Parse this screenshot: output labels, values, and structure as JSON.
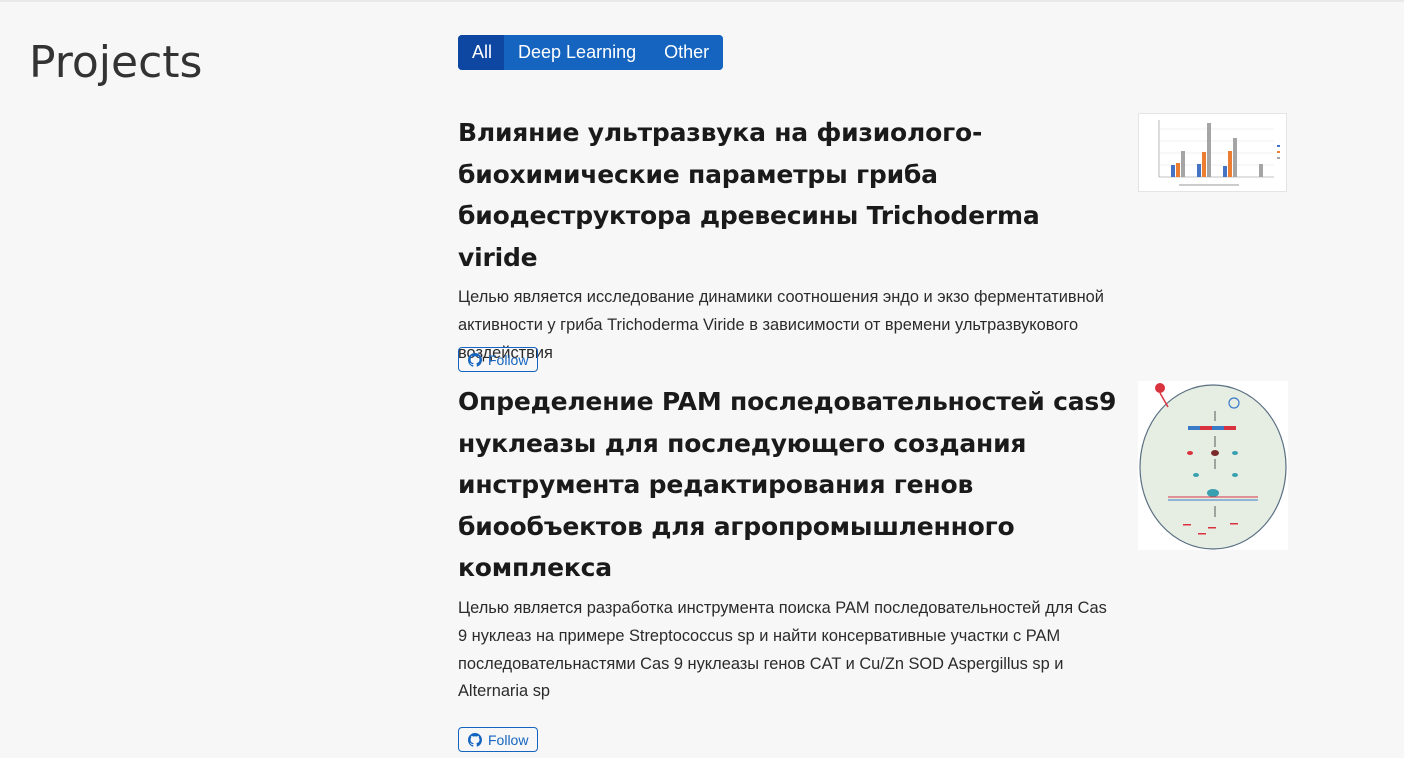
{
  "section": {
    "title": "Projects"
  },
  "filters": [
    {
      "label": "All",
      "active": true
    },
    {
      "label": "Deep Learning",
      "active": false
    },
    {
      "label": "Other",
      "active": false
    }
  ],
  "projects": [
    {
      "title": "Влияние ультразвука на физиолого-биохимические параметры гриба биодеструктора древесины Trichoderma viride",
      "title_lines": [
        "Влияние ультразвука на физиолого-",
        "биохимические параметры гриба",
        "биодеструктора древесины Trichoderma viride"
      ],
      "description": "Целью является исследование динамики соотношения эндо и экзо ферментативной активности у гриба Trichoderma Viride в зависимости от времени ультразвукового воздействия",
      "follow_label": "Follow",
      "thumbnail_icon": "bar-chart-thumbnail"
    },
    {
      "title": "Определение PAM последовательностей cas9 нуклеазы для последующего создания инструмента редактирования генов биообъектов для агропромышленного комплекса",
      "title_lines": [
        "Определение PAM последовательностей cas9",
        "нуклеазы для последующего создания",
        "инструмента редактирования генов",
        "биообъектов для агропромышленного",
        "комплекса"
      ],
      "description": "Целью является разработка инструмента поиска PAM последовательностей для Cas 9 нуклеаз на примере Streptococcus sp и найти консервативные участки с PAM последовательнастями Cas 9 нуклеазы генов CAT и Cu/Zn SOD Aspergillus sp и Alternaria sp",
      "follow_label": "Follow",
      "thumbnail_icon": "cell-diagram-thumbnail"
    }
  ],
  "colors": {
    "accent": "#1565c0",
    "accent_active": "#0d47a1",
    "background": "#f7f7f7"
  }
}
